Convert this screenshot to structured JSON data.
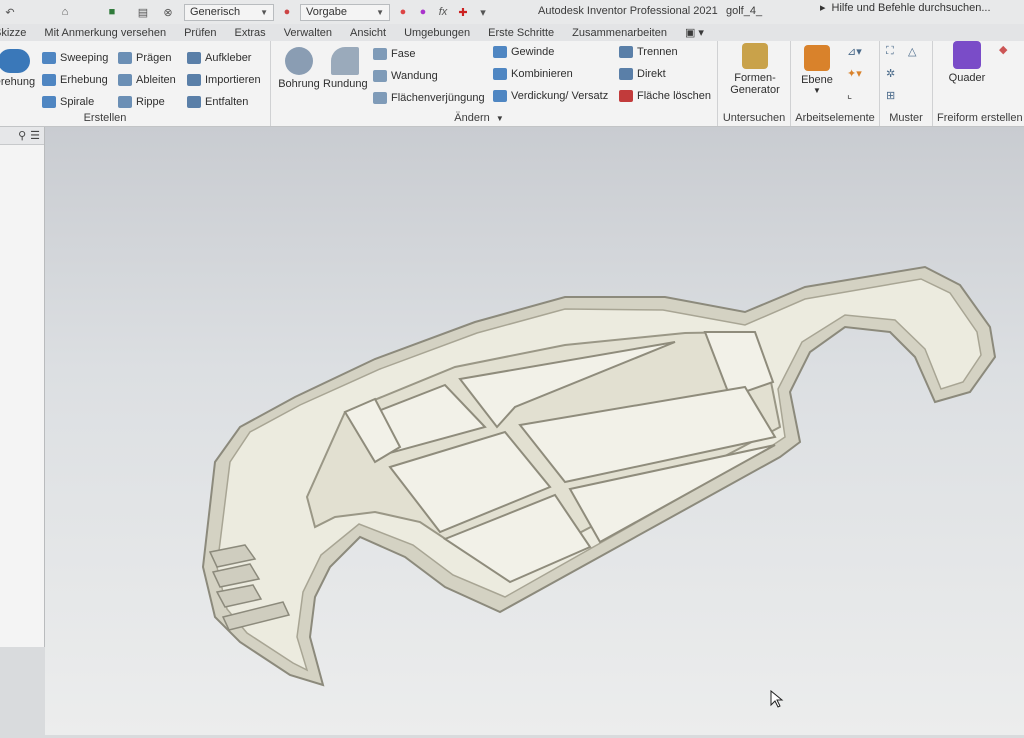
{
  "app_title": "Autodesk Inventor Professional 2021",
  "document_name": "golf_4_",
  "help_search": "Hilfe und Befehle durchsuchen...",
  "quick_access": {
    "material_dropdown": "Generisch",
    "appearance_dropdown": "Vorgabe"
  },
  "tabs": [
    "Skizze",
    "Mit Anmerkung versehen",
    "Prüfen",
    "Extras",
    "Verwalten",
    "Ansicht",
    "Umgebungen",
    "Erste Schritte",
    "Zusammenarbeiten"
  ],
  "ribbon": {
    "erstellen": {
      "label": "Erstellen",
      "drehung": "Drehung",
      "sweeping": "Sweeping",
      "erhebung": "Erhebung",
      "spirale": "Spirale",
      "praegen": "Prägen",
      "ableiten": "Ableiten",
      "rippe": "Rippe",
      "aufkleber": "Aufkleber",
      "importieren": "Importieren",
      "entfalten": "Entfalten"
    },
    "aendern": {
      "label": "Ändern",
      "bohrung": "Bohrung",
      "rundung": "Rundung",
      "fase": "Fase",
      "wandung": "Wandung",
      "flaechenverjuengung": "Flächenverjüngung",
      "gewinde": "Gewinde",
      "kombinieren": "Kombinieren",
      "verdickung": "Verdickung/ Versatz",
      "trennen": "Trennen",
      "direkt": "Direkt",
      "flaeche_loeschen": "Fläche löschen"
    },
    "untersuchen": {
      "label": "Untersuchen",
      "formen_generator_1": "Formen-",
      "formen_generator_2": "Generator"
    },
    "arbeitselemente": {
      "label": "Arbeitselemente",
      "ebene": "Ebene"
    },
    "muster": {
      "label": "Muster"
    },
    "freiform": {
      "label": "Freiform erstellen",
      "quader": "Quader"
    }
  },
  "colors": {
    "ribbon_bg": "#f3f3f3",
    "viewport_top": "#c9ccd1",
    "viewport_bottom": "#eceded",
    "part_face": "#ecebdf",
    "part_wall": "#c4c1ae",
    "accent_orange": "#d9822b",
    "accent_blue": "#3a78b9",
    "accent_purple": "#7a4cc8"
  }
}
